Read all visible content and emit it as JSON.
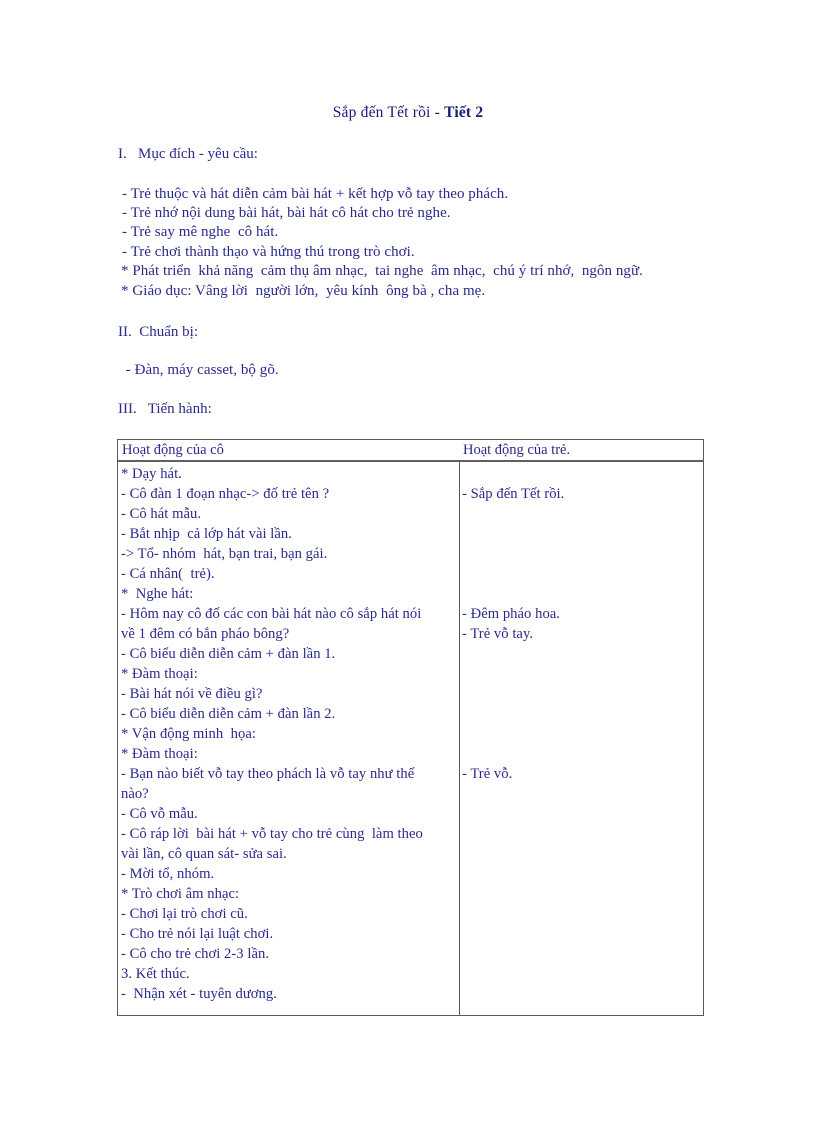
{
  "document": {
    "title_normal": "Sắp đến Tết rồi - ",
    "title_bold": "Tiết 2",
    "sections": [
      {
        "heading": "I.   Mục đích - yêu cầu:"
      },
      {
        "heading": "II.  Chuẩn bị:"
      },
      {
        "heading": "III.   Tiến hành:"
      }
    ],
    "objectives": [
      "- Trẻ thuộc và hát diễn cảm bài hát + kết hợp vỗ tay theo phách.",
      "- Trẻ nhớ nội dung bài hát, bài hát cô hát cho trẻ nghe.",
      "- Trẻ say mê nghe  cô hát.",
      "- Trẻ chơi thành thạo và hứng thú trong trò chơi.",
      "* Phát triển  khả năng  cảm thụ âm nhạc,  tai nghe  âm nhạc,  chú ý trí nhớ,  ngôn ngữ.",
      "* Giáo dục: Vâng lời  người lớn,  yêu kính  ông bà , cha mẹ."
    ],
    "preparation": [
      " - Đàn, máy casset, bộ gõ."
    ],
    "table": {
      "headers": {
        "left": "Hoạt động của cô",
        "right": "Hoạt động của trẻ."
      },
      "left_lines": [
        "* Dạy hát.",
        "- Cô đàn 1 đoạn nhạc-> đố trẻ tên ?",
        "- Cô hát mẫu.",
        "- Bắt nhịp  cả lớp hát vài lần.",
        "-> Tổ- nhóm  hát, bạn trai, bạn gái.",
        "- Cá nhân(  trẻ).",
        "*  Nghe hát:",
        "- Hôm nay cô đố các con bài hát nào cô sắp hát nói",
        "về 1 đêm có bắn pháo bông?",
        "- Cô biểu diễn diễn cảm + đàn lần 1.",
        "* Đàm thoại:",
        "- Bài hát nói về điều gì?",
        "- Cô biểu diễn diễn cảm + đàn lần 2.",
        "* Vận động minh  họa:",
        "* Đàm thoại:",
        "- Bạn nào biết vỗ tay theo phách là vỗ tay như thế",
        "nào?",
        "- Cô vỗ mẫu.",
        "- Cô ráp lời  bài hát + vỗ tay cho trẻ cùng  làm theo",
        "vài lần, cô quan sát- sửa sai.",
        "- Mời tổ, nhóm.",
        "* Trò chơi âm nhạc:",
        "- Chơi lại trò chơi cũ.",
        "- Cho trẻ nói lại luật chơi.",
        "- Cô cho trẻ chơi 2-3 lần.",
        "3. Kết thúc.",
        "-  Nhận xét - tuyên dương."
      ],
      "right_entries": [
        {
          "text": "- Sắp đến Tết rồi.",
          "line_index": 1
        },
        {
          "text": "- Đêm pháo hoa.",
          "line_index": 7
        },
        {
          "text": "- Trẻ vỗ tay.",
          "line_index": 8
        },
        {
          "text": "- Trẻ vỗ.",
          "line_index": 15
        }
      ]
    }
  }
}
